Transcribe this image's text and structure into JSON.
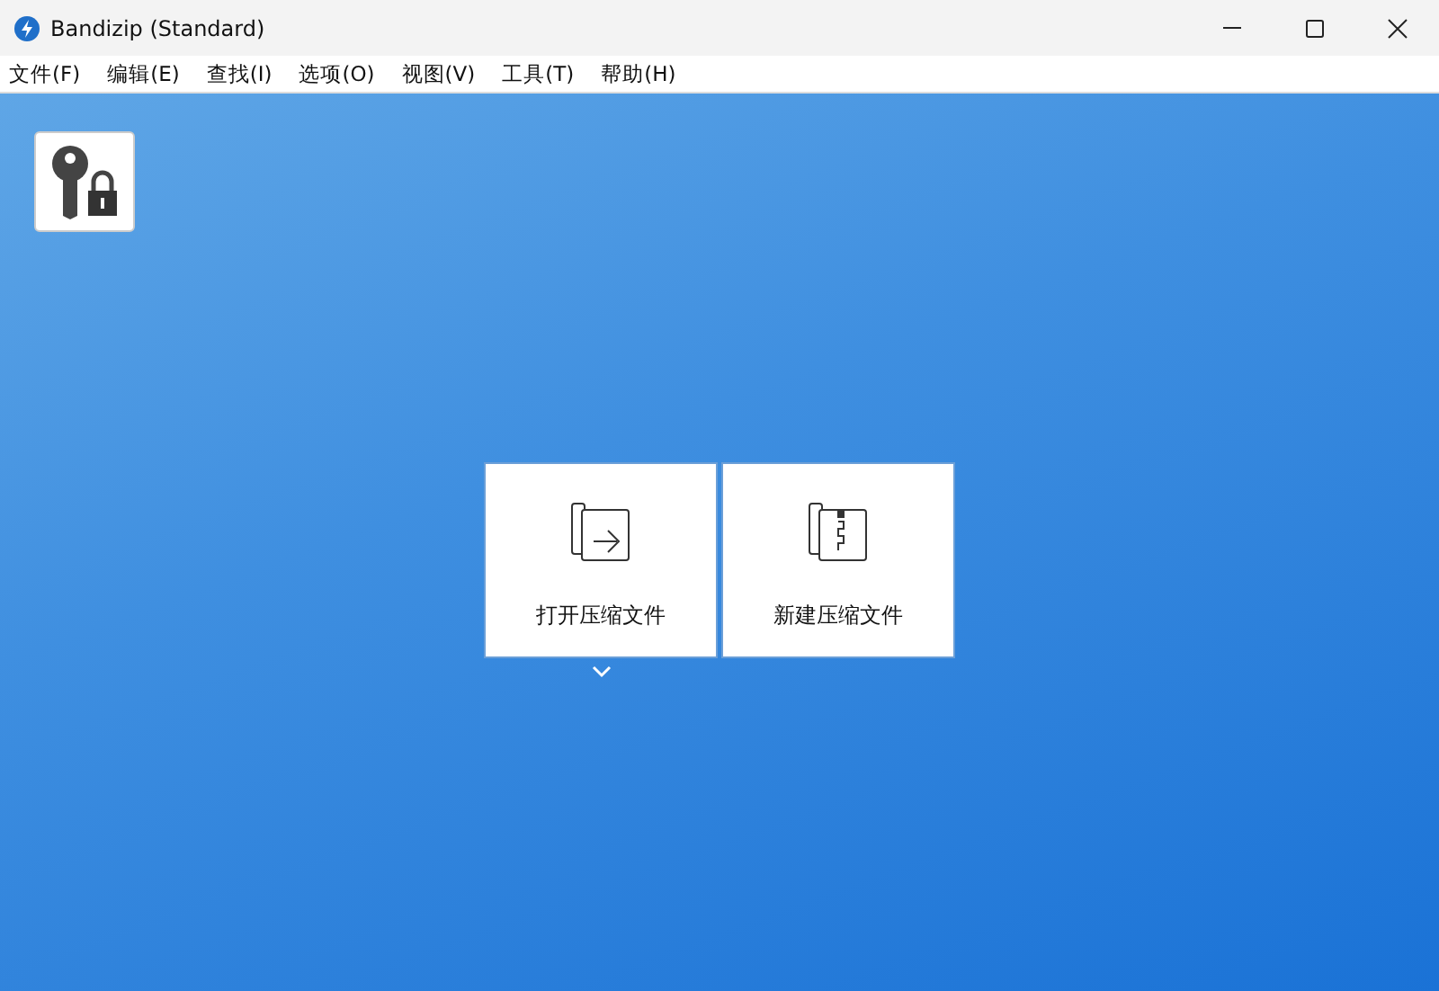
{
  "window": {
    "title": "Bandizip (Standard)"
  },
  "menu": [
    "文件(F)",
    "编辑(E)",
    "查找(I)",
    "选项(O)",
    "视图(V)",
    "工具(T)",
    "帮助(H)"
  ],
  "tiles": [
    {
      "kind": "open",
      "label": "打开压缩文件",
      "dropdown": true
    },
    {
      "kind": "new",
      "label": "新建压缩文件",
      "dropdown": false
    }
  ]
}
